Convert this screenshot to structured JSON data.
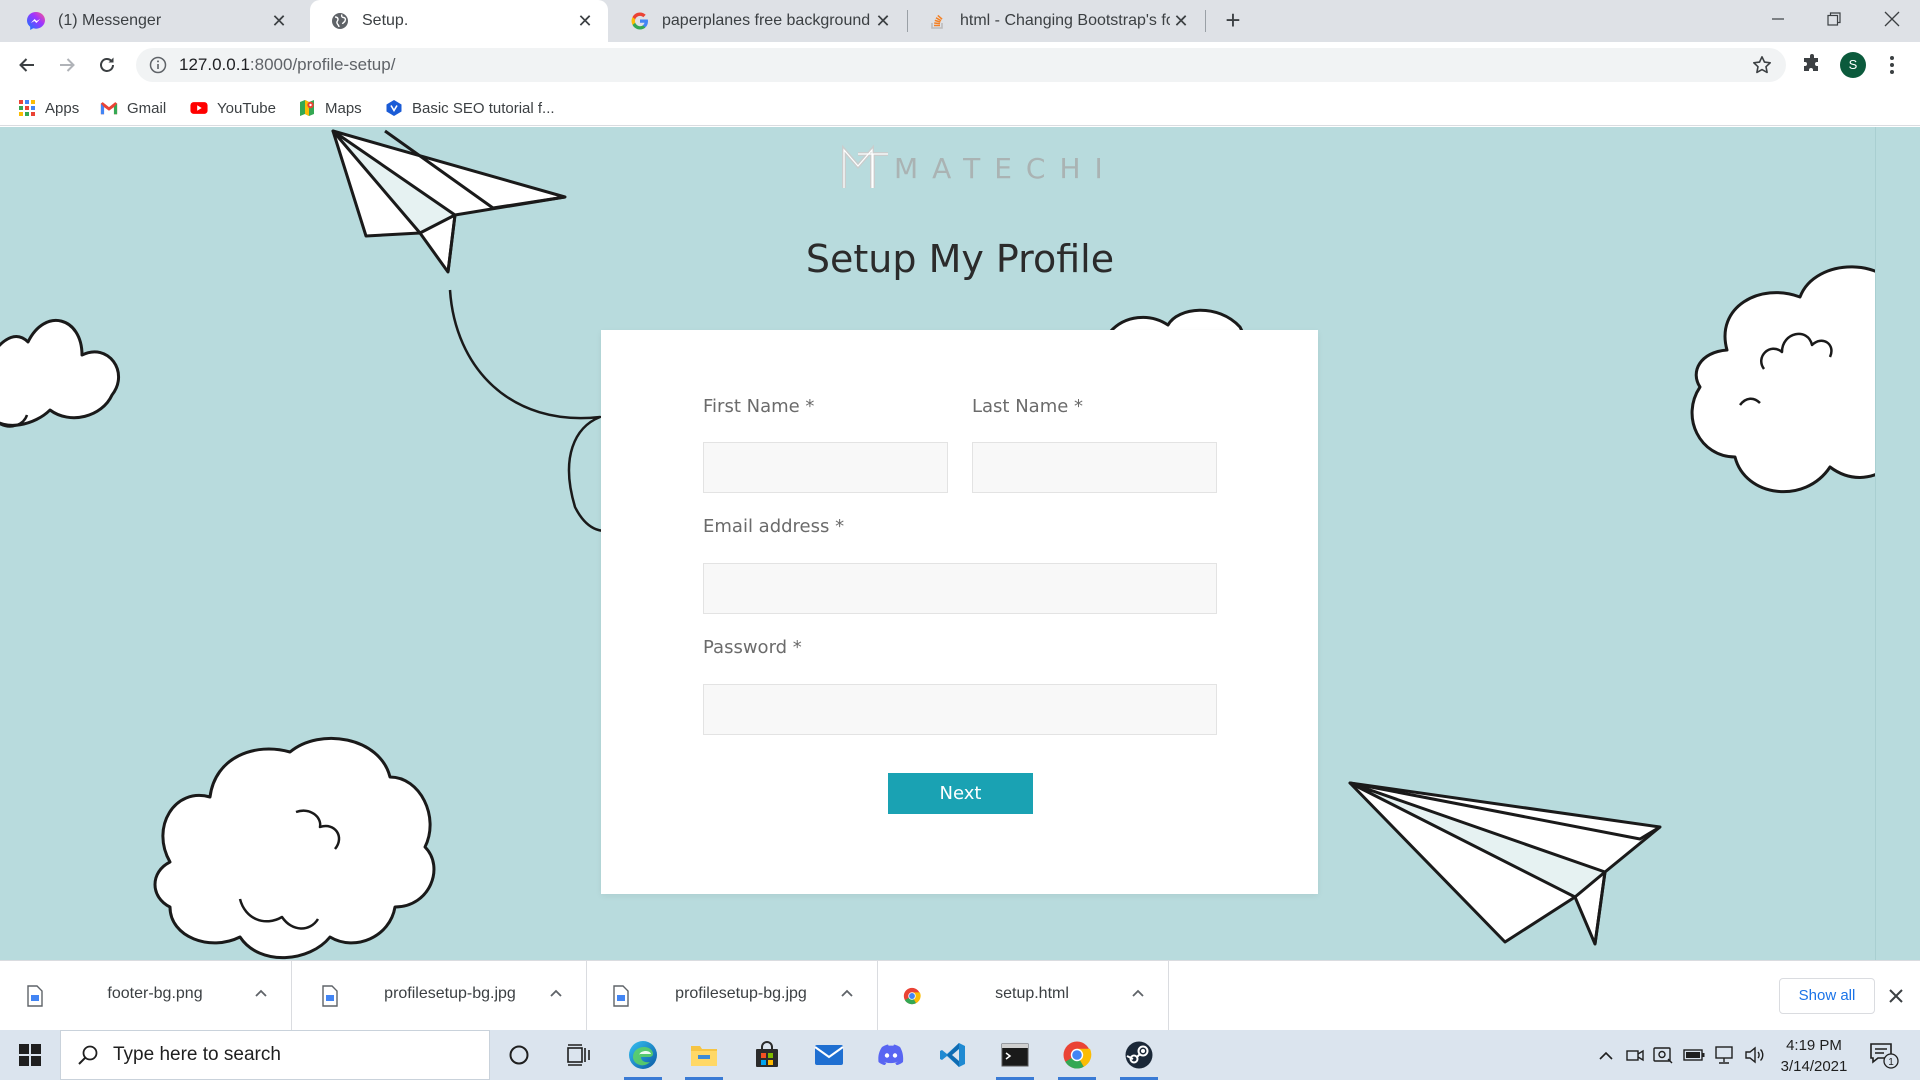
{
  "browser": {
    "tabs": [
      {
        "title": "(1) Messenger",
        "favicon": "messenger-icon",
        "active": false
      },
      {
        "title": "Setup.",
        "favicon": "globe-icon",
        "active": true
      },
      {
        "title": "paperplanes free background - G",
        "favicon": "google-icon",
        "active": false
      },
      {
        "title": "html - Changing Bootstrap's form",
        "favicon": "stackoverflow-icon",
        "active": false
      }
    ],
    "url_host": "127.0.0.1",
    "url_path": ":8000/profile-setup/",
    "profile_initial": "S",
    "bookmarks": [
      {
        "label": "Apps",
        "icon": "apps-grid-icon"
      },
      {
        "label": "Gmail",
        "icon": "gmail-icon"
      },
      {
        "label": "YouTube",
        "icon": "youtube-icon"
      },
      {
        "label": "Maps",
        "icon": "maps-icon"
      },
      {
        "label": "Basic SEO tutorial f...",
        "icon": "bookmark-site-icon"
      }
    ]
  },
  "page": {
    "logo_text": "MATECHI",
    "title": "Setup My Profile",
    "form": {
      "first_name_label": "First Name *",
      "first_name_value": "",
      "last_name_label": "Last Name *",
      "last_name_value": "",
      "email_label": "Email address *",
      "email_value": "",
      "password_label": "Password *",
      "password_value": "",
      "submit_label": "Next"
    },
    "colors": {
      "background": "#b8dbdd",
      "button": "#1aa2b3",
      "card": "#ffffff"
    }
  },
  "downloads": {
    "items": [
      {
        "name": "footer-bg.png",
        "icon": "image-file-icon"
      },
      {
        "name": "profilesetup-bg.jpg",
        "icon": "image-file-icon"
      },
      {
        "name": "profilesetup-bg.jpg",
        "icon": "image-file-icon"
      },
      {
        "name": "setup.html",
        "icon": "chrome-file-icon"
      }
    ],
    "show_all_label": "Show all"
  },
  "taskbar": {
    "search_placeholder": "Type here to search",
    "time": "4:19 PM",
    "date": "3/14/2021",
    "notification_count": "1"
  }
}
